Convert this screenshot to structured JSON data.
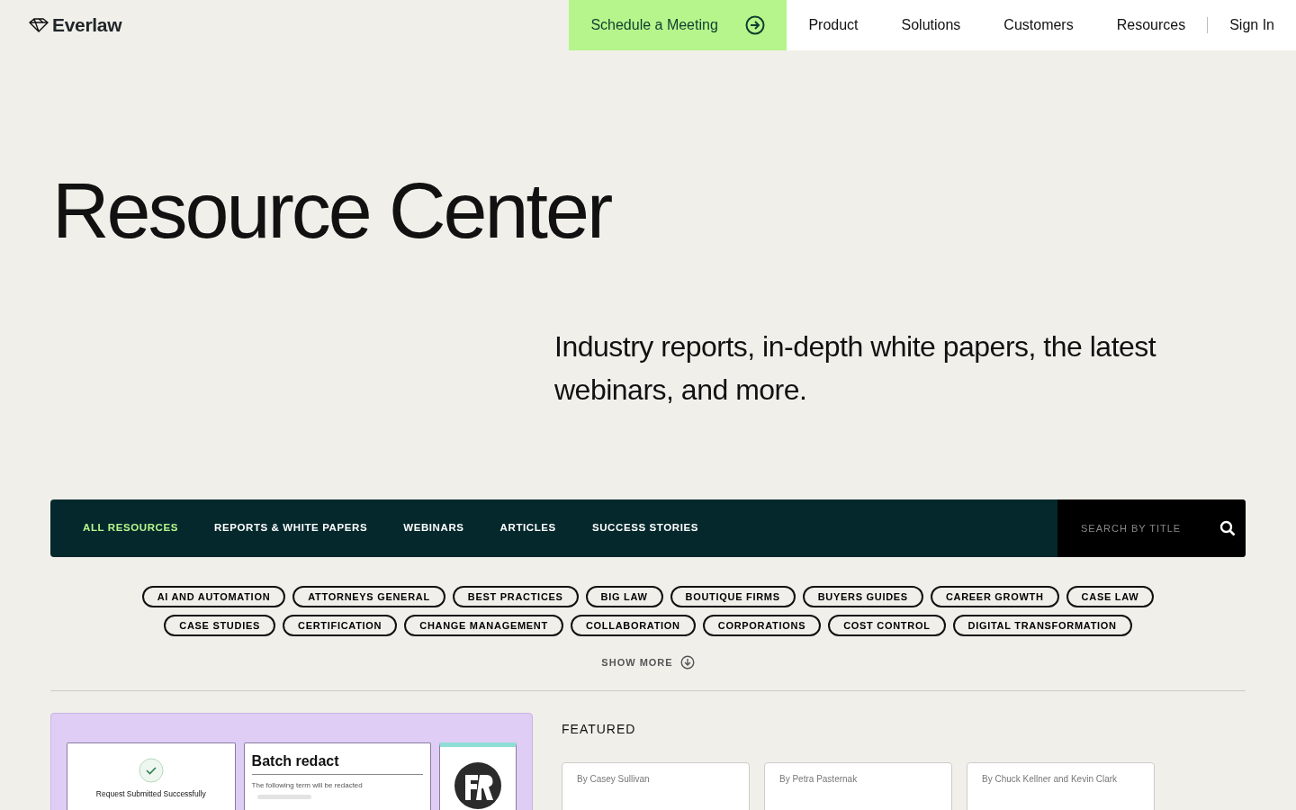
{
  "brand": "Everlaw",
  "cta": {
    "label": "Schedule a Meeting"
  },
  "nav": [
    {
      "label": "Product"
    },
    {
      "label": "Solutions"
    },
    {
      "label": "Customers"
    },
    {
      "label": "Resources"
    },
    {
      "label": "Sign In"
    }
  ],
  "title": "Resource Center",
  "subtitle": "Industry reports, in-depth white papers, the latest webinars, and more.",
  "filters": [
    {
      "label": "ALL RESOURCES",
      "selected": true
    },
    {
      "label": "REPORTS & WHITE PAPERS",
      "selected": false
    },
    {
      "label": "WEBINARS",
      "selected": false
    },
    {
      "label": "ARTICLES",
      "selected": false
    },
    {
      "label": "SUCCESS STORIES",
      "selected": false
    }
  ],
  "search": {
    "placeholder": "SEARCH BY TITLE"
  },
  "tag_rows": [
    [
      "AI AND AUTOMATION",
      "ATTORNEYS GENERAL",
      "BEST PRACTICES",
      "BIG LAW",
      "BOUTIQUE FIRMS",
      "BUYERS GUIDES",
      "CAREER GROWTH",
      "CASE LAW"
    ],
    [
      "CASE STUDIES",
      "CERTIFICATION",
      "CHANGE MANAGEMENT",
      "COLLABORATION",
      "CORPORATIONS",
      "COST CONTROL",
      "DIGITAL TRANSFORMATION"
    ]
  ],
  "show_more": "SHOW MORE",
  "hero_card": {
    "success_title": "Request Submitted Successfully",
    "redact_title": "Batch redact",
    "redact_note": "The following term will be redacted"
  },
  "featured": {
    "heading": "FEATURED",
    "cards": [
      {
        "byline": "By Casey Sullivan"
      },
      {
        "byline": "By Petra Pasternak"
      },
      {
        "byline": "By Chuck Kellner and Kevin Clark"
      }
    ]
  }
}
